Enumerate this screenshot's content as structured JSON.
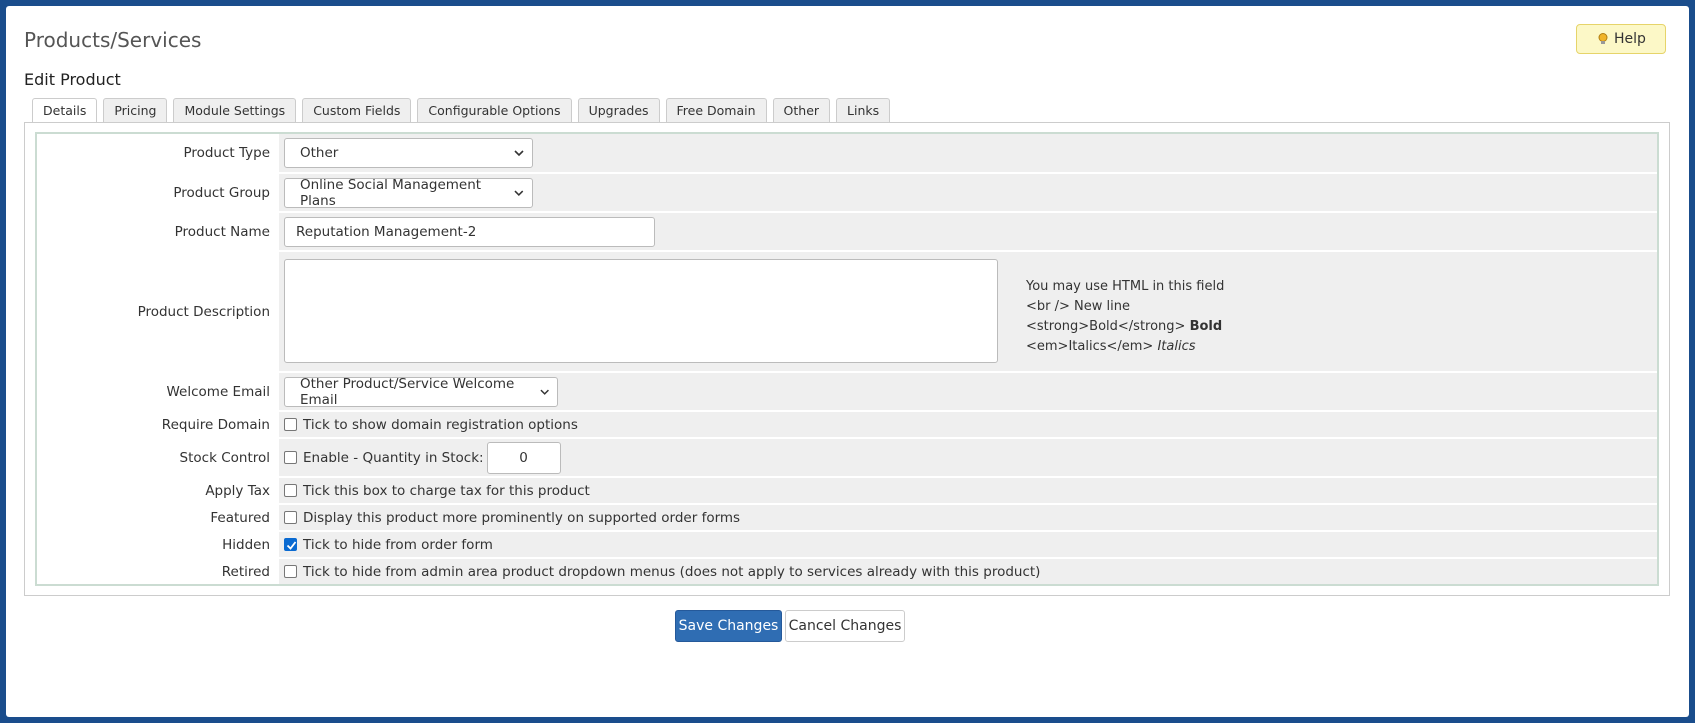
{
  "header": {
    "page_title": "Products/Services",
    "sub_title": "Edit Product",
    "help_label": "Help"
  },
  "tabs": [
    {
      "label": "Details",
      "active": true
    },
    {
      "label": "Pricing"
    },
    {
      "label": "Module Settings"
    },
    {
      "label": "Custom Fields"
    },
    {
      "label": "Configurable Options"
    },
    {
      "label": "Upgrades"
    },
    {
      "label": "Free Domain"
    },
    {
      "label": "Other"
    },
    {
      "label": "Links"
    }
  ],
  "form": {
    "product_type": {
      "label": "Product Type",
      "value": "Other"
    },
    "product_group": {
      "label": "Product Group",
      "value": "Online Social Management Plans"
    },
    "product_name": {
      "label": "Product Name",
      "value": "Reputation Management-2"
    },
    "product_description": {
      "label": "Product Description",
      "value": "",
      "help_line1": "You may use HTML in this field",
      "help_line2": "<br /> New line",
      "help_line3_code": "<strong>Bold</strong>",
      "help_line3_sample": "Bold",
      "help_line4_code": "<em>Italics</em>",
      "help_line4_sample": "Italics"
    },
    "welcome_email": {
      "label": "Welcome Email",
      "value": "Other Product/Service Welcome Email"
    },
    "require_domain": {
      "label": "Require Domain",
      "text": "Tick to show domain registration options",
      "checked": false
    },
    "stock_control": {
      "label": "Stock Control",
      "text": "Enable - Quantity in Stock:",
      "checked": false,
      "quantity": "0"
    },
    "apply_tax": {
      "label": "Apply Tax",
      "text": "Tick this box to charge tax for this product",
      "checked": false
    },
    "featured": {
      "label": "Featured",
      "text": "Display this product more prominently on supported order forms",
      "checked": false
    },
    "hidden": {
      "label": "Hidden",
      "text": "Tick to hide from order form",
      "checked": true
    },
    "retired": {
      "label": "Retired",
      "text": "Tick to hide from admin area product dropdown menus (does not apply to services already with this product)",
      "checked": false
    }
  },
  "actions": {
    "save_label": "Save Changes",
    "cancel_label": "Cancel Changes"
  },
  "colors": {
    "primary_button": "#2f6db3",
    "help_button_bg": "#fcf8c7",
    "frame_border": "#1a4d8c",
    "checkbox_checked": "#0a6ad1"
  }
}
